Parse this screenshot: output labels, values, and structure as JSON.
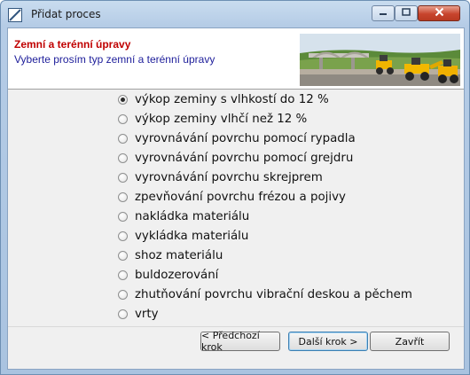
{
  "window": {
    "title": "Přidat proces",
    "icon": "app-slash-icon"
  },
  "header": {
    "title": "Zemní a terénní úpravy",
    "subtitle": "Vyberte prosím typ zemní a terénní úpravy",
    "image": "construction-site-image"
  },
  "options": [
    {
      "label": "výkop zeminy s vlhkostí do 12 %",
      "selected": true
    },
    {
      "label": "výkop zeminy vlhčí než 12 %",
      "selected": false
    },
    {
      "label": "vyrovnávání povrchu pomocí rypadla",
      "selected": false
    },
    {
      "label": "vyrovnávání povrchu pomocí grejdru",
      "selected": false
    },
    {
      "label": "vyrovnávání povrchu skrejprem",
      "selected": false
    },
    {
      "label": "zpevňování povrchu frézou a pojivy",
      "selected": false
    },
    {
      "label": "nakládka materiálu",
      "selected": false
    },
    {
      "label": "vykládka materiálu",
      "selected": false
    },
    {
      "label": "shoz materiálu",
      "selected": false
    },
    {
      "label": "buldozerování",
      "selected": false
    },
    {
      "label": "zhutňování povrchu vibrační deskou a pěchem",
      "selected": false
    },
    {
      "label": "vrty",
      "selected": false
    }
  ],
  "buttons": {
    "prev": "< Předchozí krok",
    "next": "Další krok >",
    "close": "Zavřít"
  },
  "colors": {
    "header_title": "#c00000",
    "header_subtitle": "#1d1d9a"
  }
}
